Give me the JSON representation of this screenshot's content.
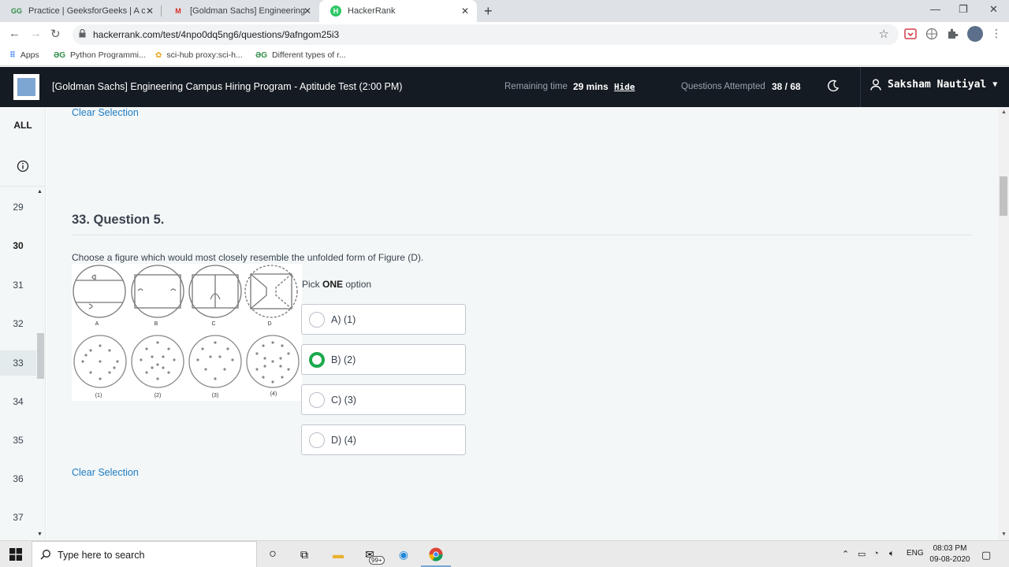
{
  "browser": {
    "tabs": [
      {
        "title": "Practice | GeeksforGeeks | A com",
        "active": false
      },
      {
        "title": "[Goldman Sachs] Engineering Ca",
        "active": false
      },
      {
        "title": "HackerRank",
        "active": true
      }
    ],
    "url": "hackerrank.com/test/4npo0dq5ng6/questions/9afngom25i3",
    "bookmarks": [
      {
        "label": "Apps",
        "icon": "apps-grid-icon"
      },
      {
        "label": "Python Programmi...",
        "icon": "gfg-icon"
      },
      {
        "label": "sci-hub proxy:sci-h...",
        "icon": "scihub-icon"
      },
      {
        "label": "Different types of r...",
        "icon": "gfg-icon"
      }
    ]
  },
  "header": {
    "title": "[Goldman Sachs] Engineering Campus Hiring Program - Aptitude Test (2:00 PM)",
    "remaining_label": "Remaining time",
    "remaining_value": "29 mins",
    "hide_label": "Hide",
    "attempted_label": "Questions Attempted",
    "attempted_value": "38 / 68",
    "user_name": "Saksham Nautiyal"
  },
  "sidebar": {
    "all_label": "ALL",
    "numbers": [
      "29",
      "30",
      "31",
      "32",
      "33",
      "34",
      "35",
      "36",
      "37"
    ],
    "bold_numbers": [
      "30"
    ],
    "current": "33"
  },
  "question": {
    "clear_top": "Clear Selection",
    "title": "33. Question 5.",
    "text": "Choose a figure which would most closely resemble the unfolded form of Figure (D).",
    "pick_prefix": "Pick ",
    "pick_bold": "ONE",
    "pick_suffix": " option",
    "figure_top_labels": [
      "A",
      "B",
      "C",
      "D"
    ],
    "figure_bottom_labels": [
      "(1)",
      "(2)",
      "(3)",
      "(4)"
    ],
    "options": [
      {
        "label": "A) (1)",
        "selected": false
      },
      {
        "label": "B) (2)",
        "selected": true
      },
      {
        "label": "C) (3)",
        "selected": false
      },
      {
        "label": "D) (4)",
        "selected": false
      }
    ],
    "clear_bottom": "Clear Selection"
  },
  "taskbar": {
    "search_placeholder": "Type here to search",
    "badge": "99+",
    "lang": "ENG",
    "time": "08:03 PM",
    "date": "09-08-2020"
  },
  "colors": {
    "header_bg": "#141b22",
    "link": "#1f7bc1",
    "selected_green": "#1ba94c",
    "page_bg": "#f3f7f7"
  }
}
